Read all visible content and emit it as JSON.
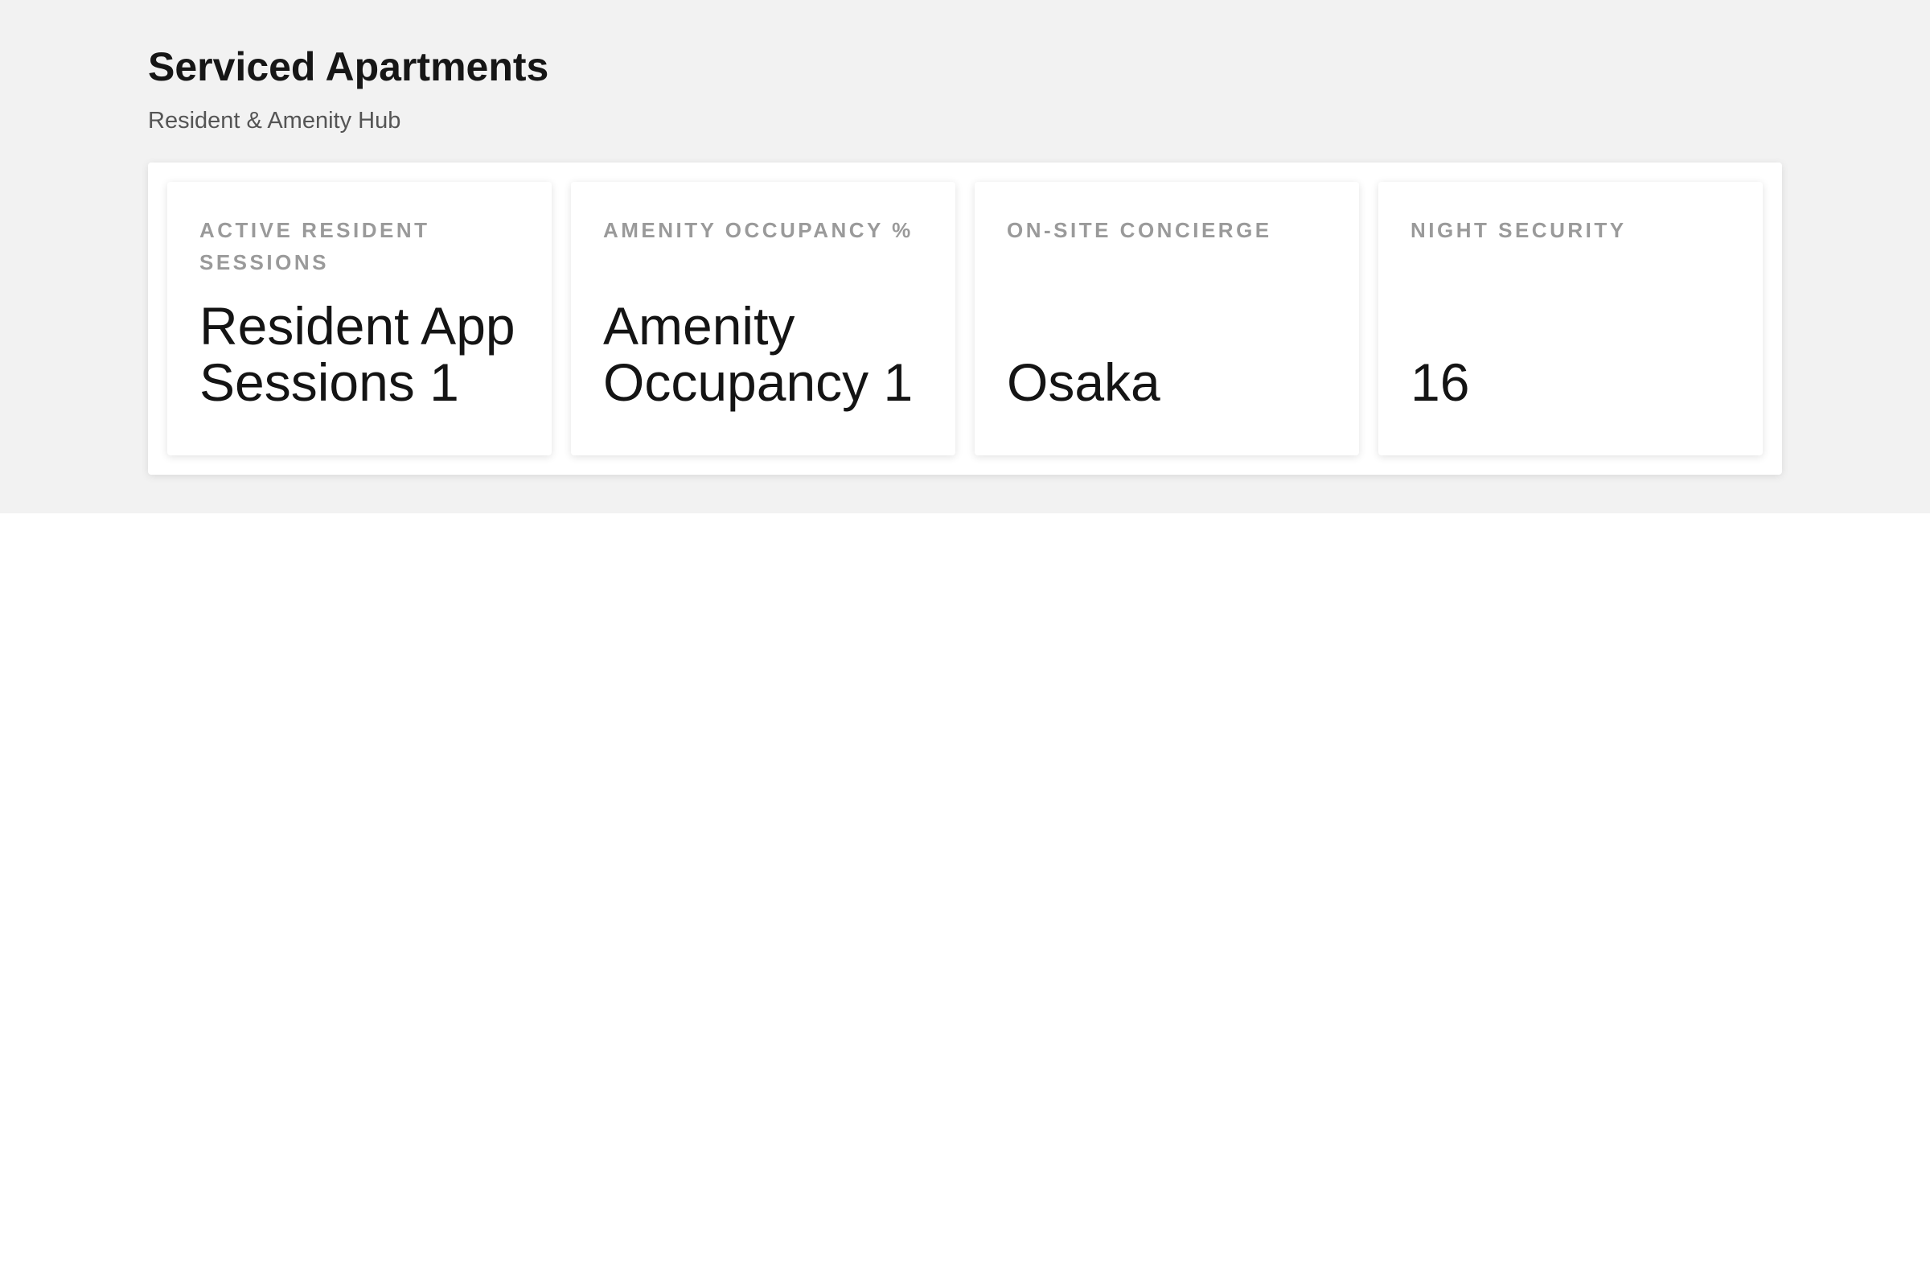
{
  "header": {
    "title": "Serviced Apartments",
    "subtitle": "Resident & Amenity Hub"
  },
  "cards": [
    {
      "label": "ACTIVE RESIDENT SESSIONS",
      "value": "Resident App Sessions 1"
    },
    {
      "label": "AMENITY OCCUPANCY %",
      "value": "Amenity Occupancy 1"
    },
    {
      "label": "ON-SITE CONCIERGE",
      "value": "Osaka"
    },
    {
      "label": "NIGHT SECURITY",
      "value": "16"
    }
  ]
}
